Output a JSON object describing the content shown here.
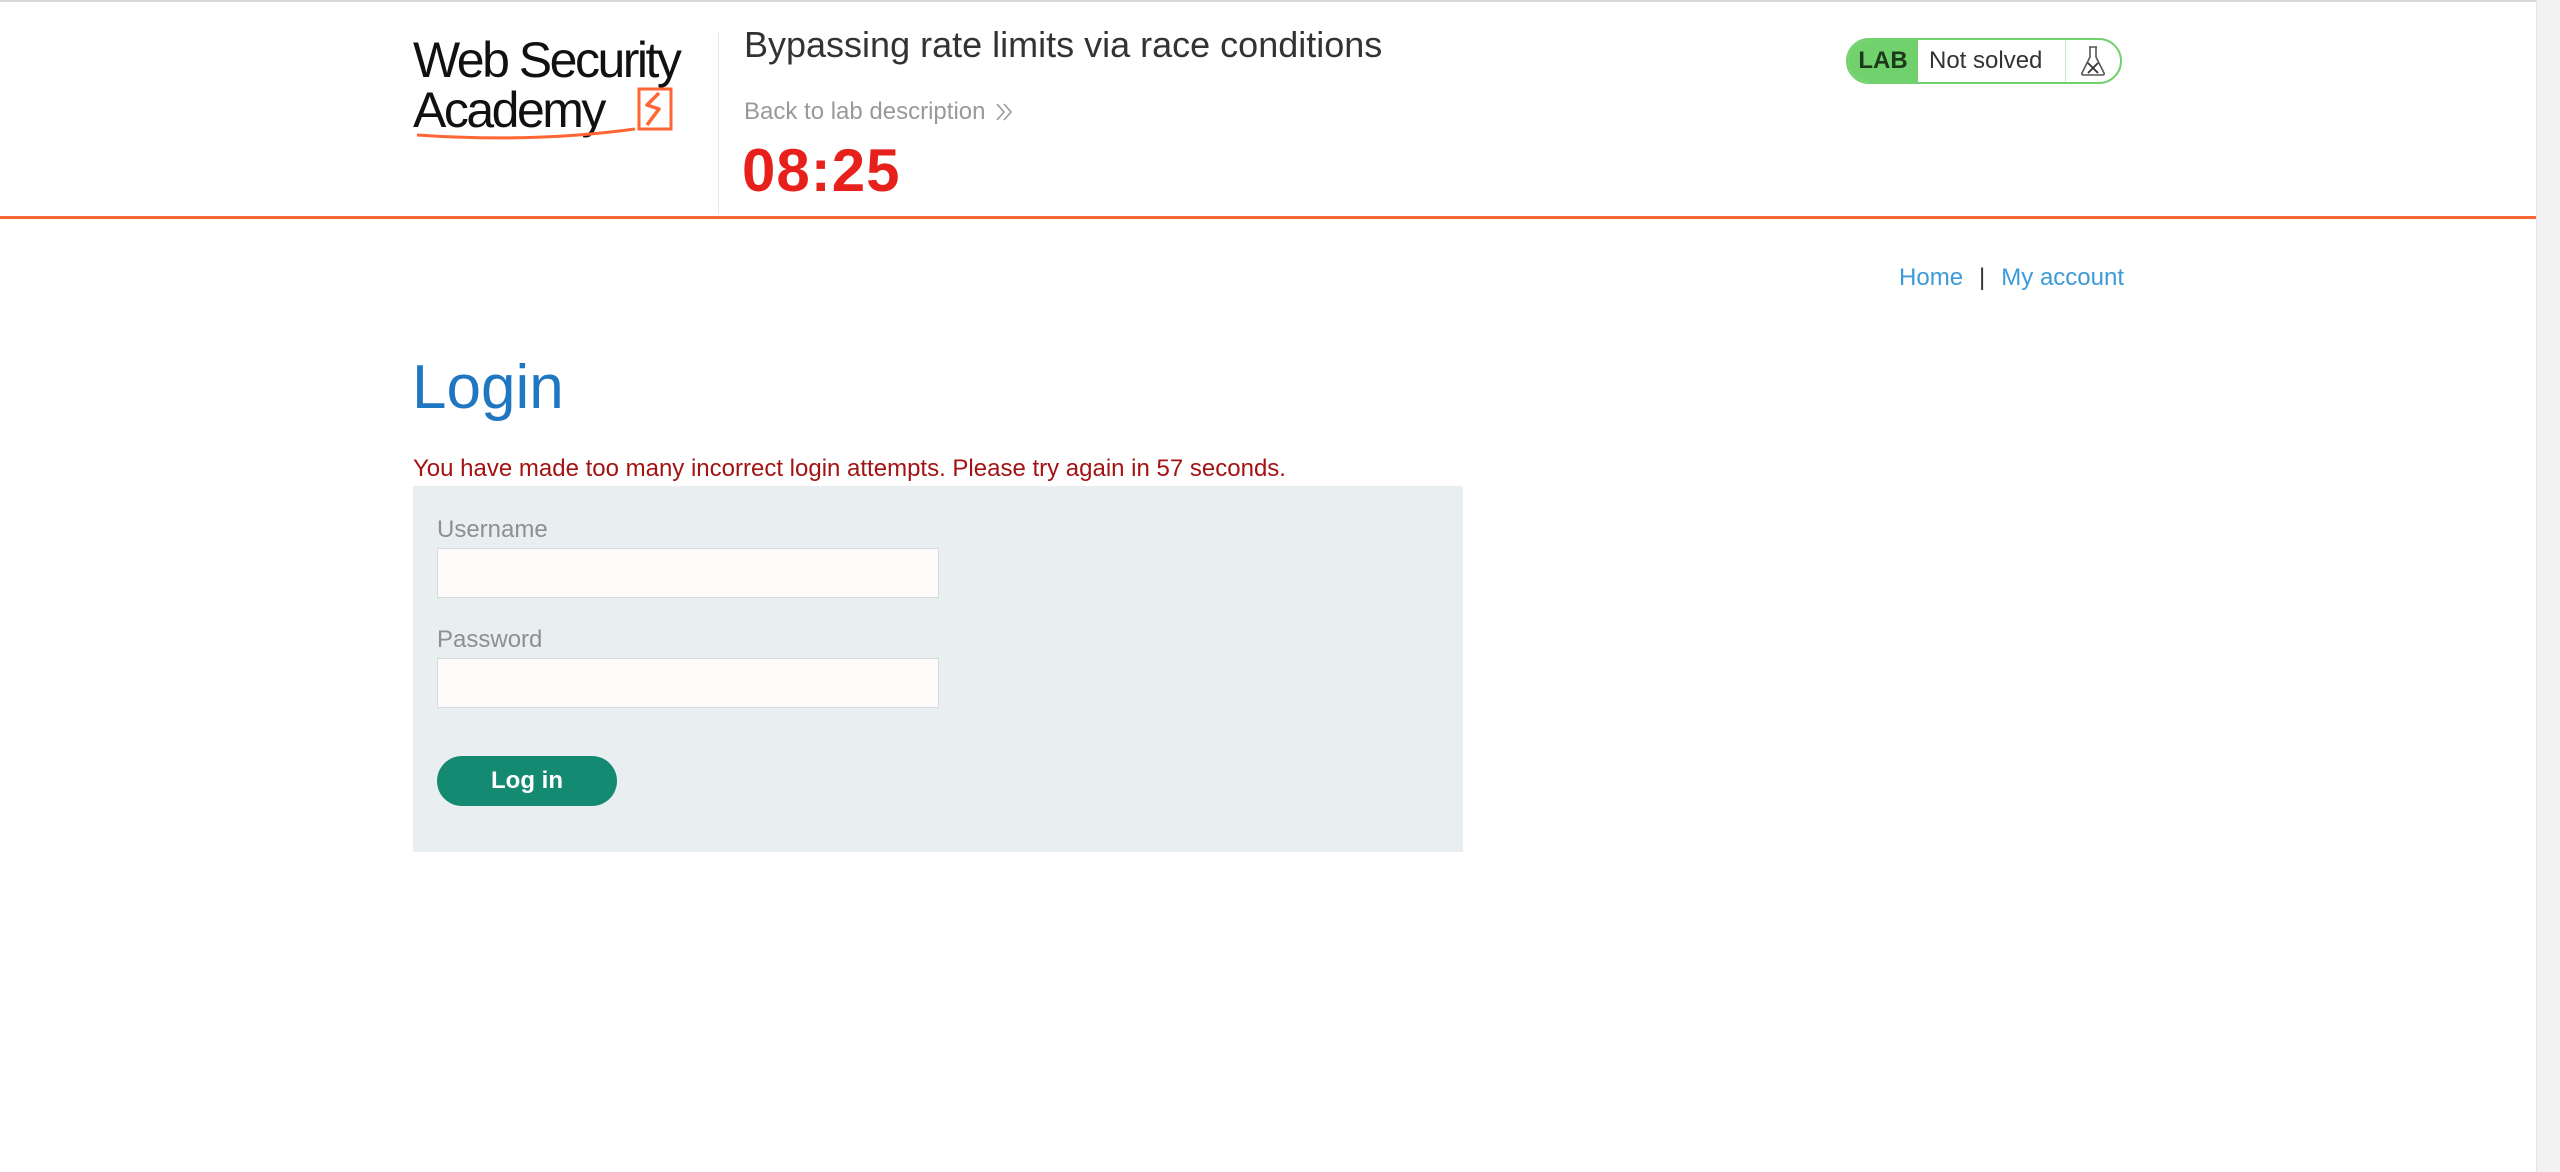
{
  "header": {
    "logo_alt": "Web Security Academy",
    "lab_title": "Bypassing rate limits via race conditions",
    "back_link": "Back to lab description",
    "timer": "08:25",
    "status": {
      "badge": "LAB",
      "state": "Not solved",
      "icon": "flask-icon"
    }
  },
  "nav": {
    "home": "Home",
    "separator": "|",
    "my_account": "My account"
  },
  "login": {
    "title": "Login",
    "error": "You have made too many incorrect login attempts. Please try again in 57 seconds.",
    "username_label": "Username",
    "username_value": "",
    "password_label": "Password",
    "password_value": "",
    "submit_label": "Log in"
  },
  "colors": {
    "accent_orange": "#ff6633",
    "timer_red": "#e8201c",
    "link_blue": "#3d9ad9",
    "title_blue": "#1f77c2",
    "error_red": "#a31313",
    "button_green": "#148a72",
    "lab_green": "#70d16d",
    "panel_gray": "#e9eef1"
  }
}
